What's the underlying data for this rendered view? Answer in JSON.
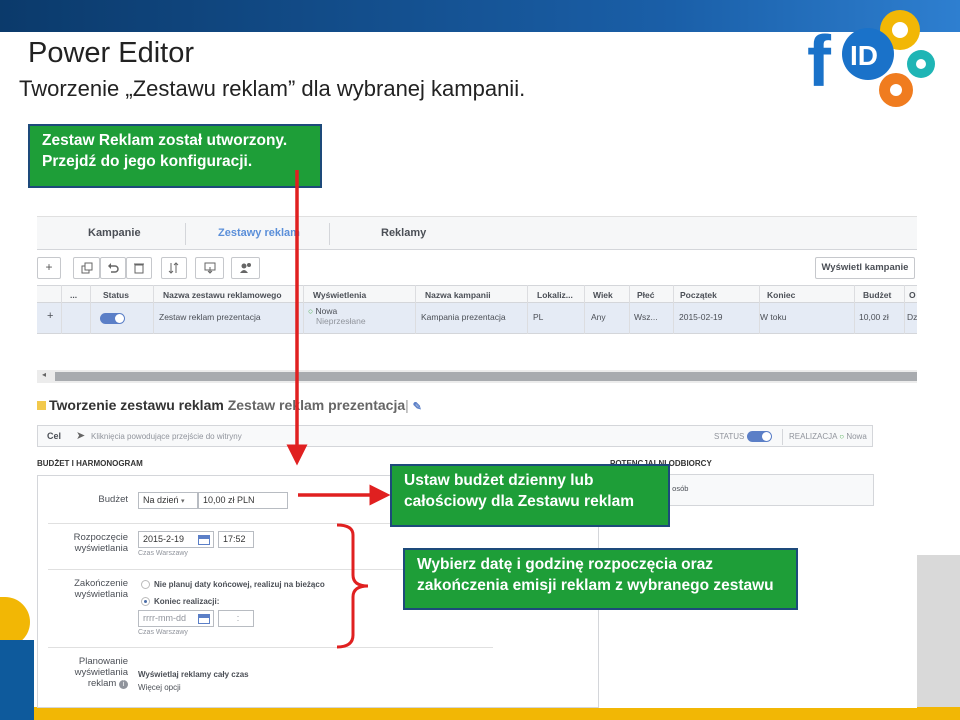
{
  "slide": {
    "title": "Power Editor",
    "subtitle": "Tworzenie „Zestawu reklam” dla wybranej kampanii."
  },
  "logo": {
    "letter_f": "f",
    "letters_id": "ID"
  },
  "callouts": {
    "created_line1": "Zestaw Reklam został utworzony.",
    "created_line2": "Przejdź do jego konfiguracji.",
    "budget_line1": "Ustaw budżet dzienny lub",
    "budget_line2": "całościowy dla Zestawu reklam",
    "dates_line1": "Wybierz datę i godzinę rozpoczęcia oraz",
    "dates_line2": "zakończenia emisji reklam z wybranego zestawu"
  },
  "tabs": [
    {
      "label": "Kampanie",
      "active": false
    },
    {
      "label": "Zestawy reklam",
      "active": true
    },
    {
      "label": "Reklamy",
      "active": false
    }
  ],
  "toolbar": {
    "add_label": "+",
    "view_campaigns": "Wyświetl kampanie",
    "icons": [
      "duplicate-icon",
      "undo-icon",
      "delete-icon",
      "sort-icon",
      "import-export-icon",
      "users-icon"
    ]
  },
  "table": {
    "headers": [
      "...",
      "Status",
      "Nazwa zestawu reklamowego",
      "Wyświetlenia",
      "Nazwa kampanii",
      "Lokaliz...",
      "Wiek",
      "Płeć",
      "Początek",
      "Koniec",
      "Budżet",
      "O"
    ],
    "row": {
      "plus": "+",
      "name": "Zestaw reklam prezentacja",
      "impressions_status": "Nowa",
      "impressions_sub": "Nieprzesłane",
      "campaign": "Kampania prezentacja",
      "location": "PL",
      "age": "Any",
      "gender": "Wsz...",
      "start": "2015-02-19",
      "end": "W toku",
      "budget": "10,00 zł",
      "extra": "Dz"
    }
  },
  "section": {
    "title": "Tworzenie zestawu reklam",
    "name": "Zestaw reklam prezentacja",
    "separator": "|"
  },
  "cel": {
    "label": "Cel",
    "objective": "Kliknięcia powodujące przejście do witryny",
    "status_label": "STATUS",
    "realizacja_label": "REALIZACJA",
    "realizacja_value": "Nowa"
  },
  "budget_schedule": {
    "header": "BUDŻET I HARMONOGRAM",
    "budget_label": "Budżet",
    "budget_type": "Na dzień",
    "budget_value": "10,00 zł PLN",
    "start_label_1": "Rozpoczęcie",
    "start_label_2": "wyświetlania",
    "start_date": "2015-2-19",
    "start_time": "17:52",
    "timezone": "Czas Warszawy",
    "end_label_1": "Zakończenie",
    "end_label_2": "wyświetlania",
    "end_option_1": "Nie planuj daty końcowej, realizuj na bieżąco",
    "end_option_2": "Koniec realizacji:",
    "end_date_placeholder": "rrrr-mm-dd",
    "end_time_sep": ":",
    "end_timezone": "Czas Warszawy",
    "plan_label_1": "Planowanie",
    "plan_label_2": "wyświetlania",
    "plan_label_3": "reklam",
    "plan_value": "Wyświetlaj reklamy cały czas",
    "more_options": "Więcej opcji"
  },
  "audience": {
    "header": "POTENCJALNI ODBIORCY",
    "reach": "asięg: 11 000 000 osób"
  },
  "colors": {
    "callout_green": "#1e9e38",
    "arrow_red": "#e02020",
    "accent_blue": "#5b7fc7"
  }
}
